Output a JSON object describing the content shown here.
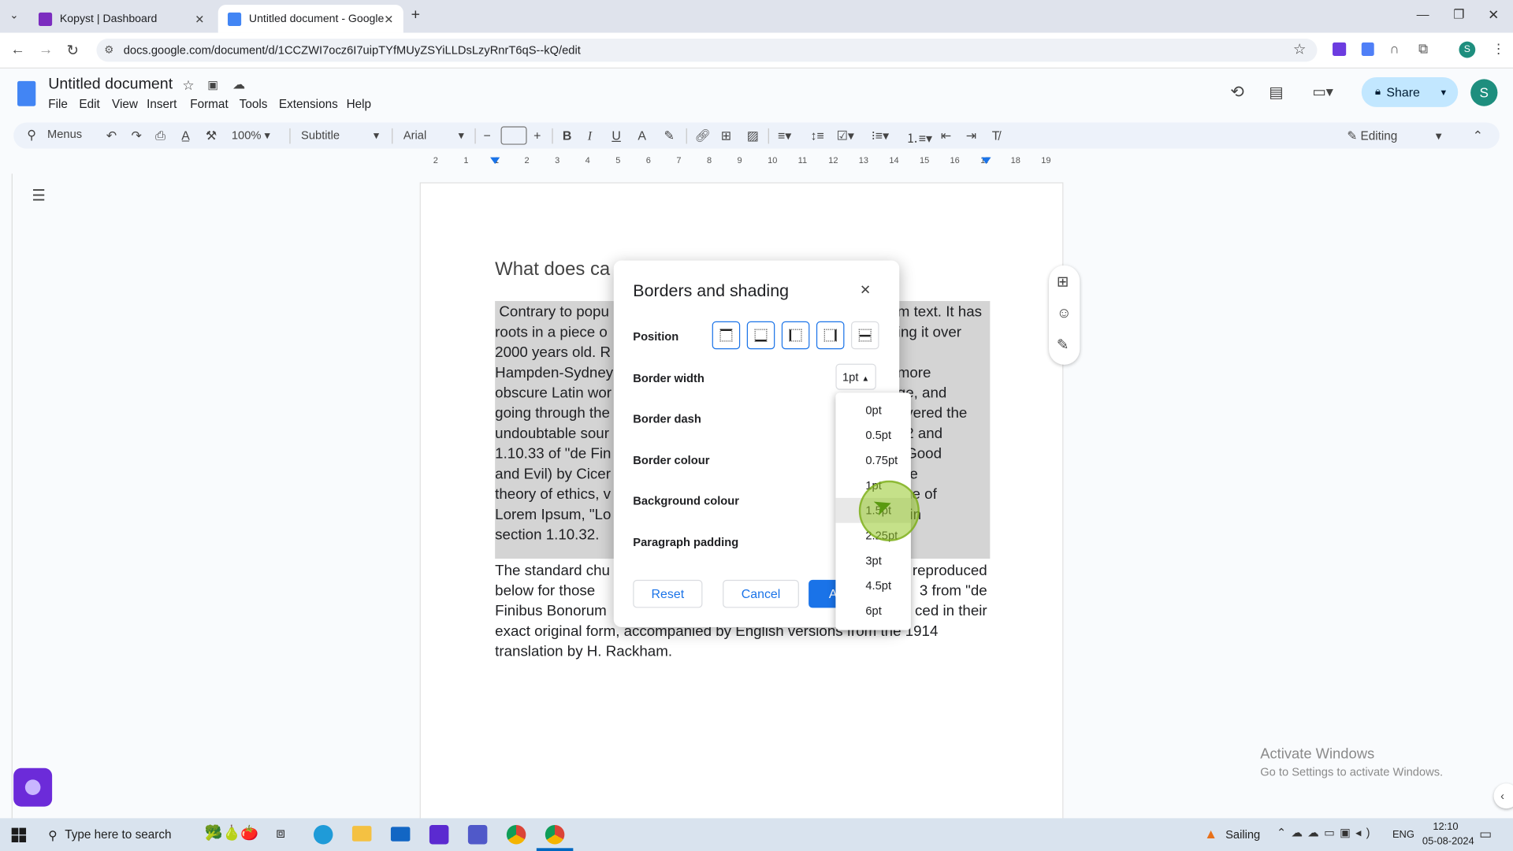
{
  "browser": {
    "tabs": [
      {
        "title": "Kopyst | Dashboard",
        "active": false
      },
      {
        "title": "Untitled document - Google Do",
        "active": true
      }
    ],
    "url": "docs.google.com/document/d/1CCZWI7ocz6I7uipTYfMUyZSYiLLDsLzyRnrT6qS--kQ/edit"
  },
  "docs": {
    "title": "Untitled document",
    "menus": [
      "File",
      "Edit",
      "View",
      "Insert",
      "Format",
      "Tools",
      "Extensions",
      "Help"
    ],
    "share_label": "Share",
    "avatar": "S",
    "toolbar": {
      "menus_label": "Menus",
      "zoom": "100%",
      "style": "Subtitle",
      "font": "Arial",
      "font_size": "",
      "mode": "Editing"
    },
    "ruler_numbers": [
      "2",
      "1",
      "1",
      "2",
      "3",
      "4",
      "5",
      "6",
      "7",
      "8",
      "9",
      "10",
      "11",
      "12",
      "13",
      "14",
      "15",
      "16",
      "17",
      "18",
      "19"
    ],
    "heading": "What does ca",
    "para1_lines": [
      " Contrary to popu",
      "roots in a piece o",
      "2000 years old. R",
      "Hampden-Sydney",
      "obscure Latin wor",
      "going through the",
      "undoubtable sour",
      "1.10.33 of \"de Fin",
      "and Evil) by Cicer",
      "theory of ethics, v",
      "Lorem Ipsum, \"Lo",
      "section 1.10.32."
    ],
    "para1_right": [
      "m text. It has",
      "ing it over",
      "",
      "more",
      "ge, and",
      "overed the",
      "32 and",
      "f Good",
      "the",
      "line of",
      "e in",
      ""
    ],
    "para2_lines": [
      {
        "l": "The standard chu",
        "r": "reproduced"
      },
      {
        "l": "below for those",
        "r": "3 from \"de"
      },
      {
        "l": "Finibus Bonorum",
        "r": "ced in their"
      },
      {
        "l": "exact original form, accompanied by English versions from the 1914",
        "r": ""
      },
      {
        "l": "translation by H. Rackham.",
        "r": ""
      }
    ]
  },
  "dialog": {
    "title": "Borders and shading",
    "position_label": "Position",
    "border_width_label": "Border width",
    "border_width_value": "1pt",
    "border_dash_label": "Border dash",
    "border_colour_label": "Border colour",
    "background_colour_label": "Background colour",
    "paragraph_padding_label": "Paragraph padding",
    "reset_label": "Reset",
    "cancel_label": "Cancel",
    "apply_label": "A",
    "width_options": [
      "0pt",
      "0.5pt",
      "0.75pt",
      "1pt",
      "1.5pt",
      "2.25pt",
      "3pt",
      "4.5pt",
      "6pt"
    ],
    "hovered_option": "1.5pt"
  },
  "watermark": {
    "line1": "Activate Windows",
    "line2": "Go to Settings to activate Windows."
  },
  "taskbar": {
    "search_placeholder": "Type here to search",
    "weather": "Sailing",
    "lang": "ENG",
    "time": "12:10",
    "date": "05-08-2024"
  }
}
